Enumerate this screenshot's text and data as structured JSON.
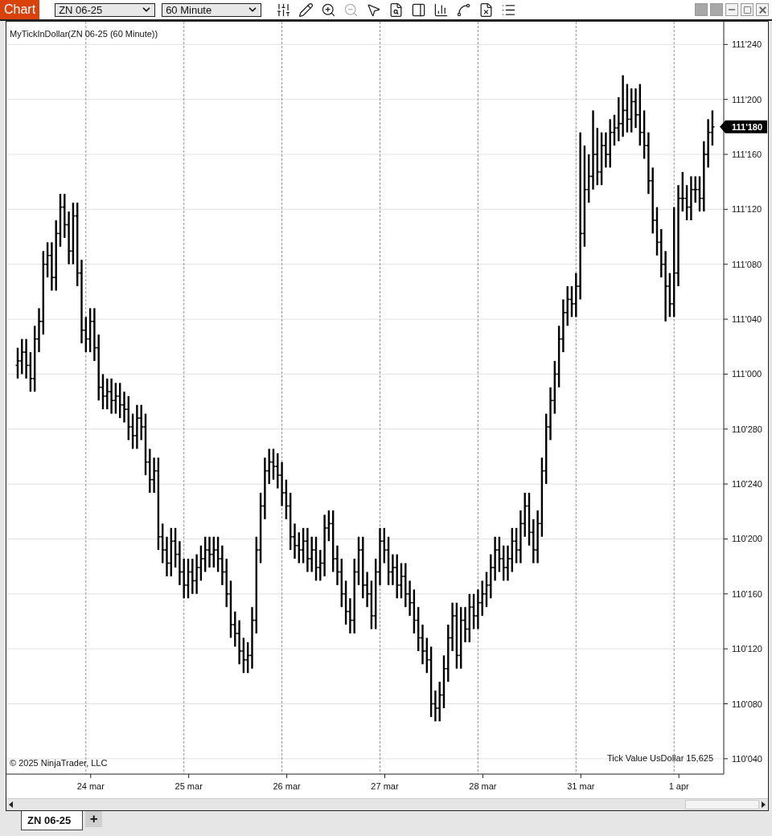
{
  "toolbar": {
    "app_button": "Chart",
    "instrument": "ZN 06-25",
    "interval": "60 Minute",
    "tools": [
      {
        "kind": "sliders",
        "disabled": false
      },
      {
        "kind": "pencil",
        "disabled": false
      },
      {
        "kind": "zoom-in",
        "disabled": false
      },
      {
        "kind": "zoom-out",
        "disabled": true
      },
      {
        "kind": "pointer",
        "disabled": false
      },
      {
        "kind": "file-search",
        "disabled": false
      },
      {
        "kind": "panel",
        "disabled": false
      },
      {
        "kind": "bar-chart",
        "disabled": false
      },
      {
        "kind": "line-chart",
        "disabled": false
      },
      {
        "kind": "file-x",
        "disabled": false
      },
      {
        "kind": "list",
        "disabled": false
      }
    ]
  },
  "chart": {
    "indicator_label": "MyTickInDollar(ZN 06-25 (60 Minute))",
    "copyright": "© 2025 NinjaTrader, LLC",
    "tick_value": "Tick Value UsDollar 15,625",
    "price_marker": "111'180",
    "price_axis": [
      "111'240",
      "111'200",
      "111'160",
      "111'120",
      "111'080",
      "111'040",
      "111'000",
      "110'280",
      "110'240",
      "110'200",
      "110'160",
      "110'120",
      "110'080",
      "110'040"
    ],
    "time_axis": [
      "24 mar",
      "25 mar",
      "26 mar",
      "27 mar",
      "28 mar",
      "31 mar",
      "1 apr"
    ]
  },
  "tabs": [
    {
      "label": "ZN 06-25",
      "selected": true
    }
  ],
  "add_tab": "+"
}
